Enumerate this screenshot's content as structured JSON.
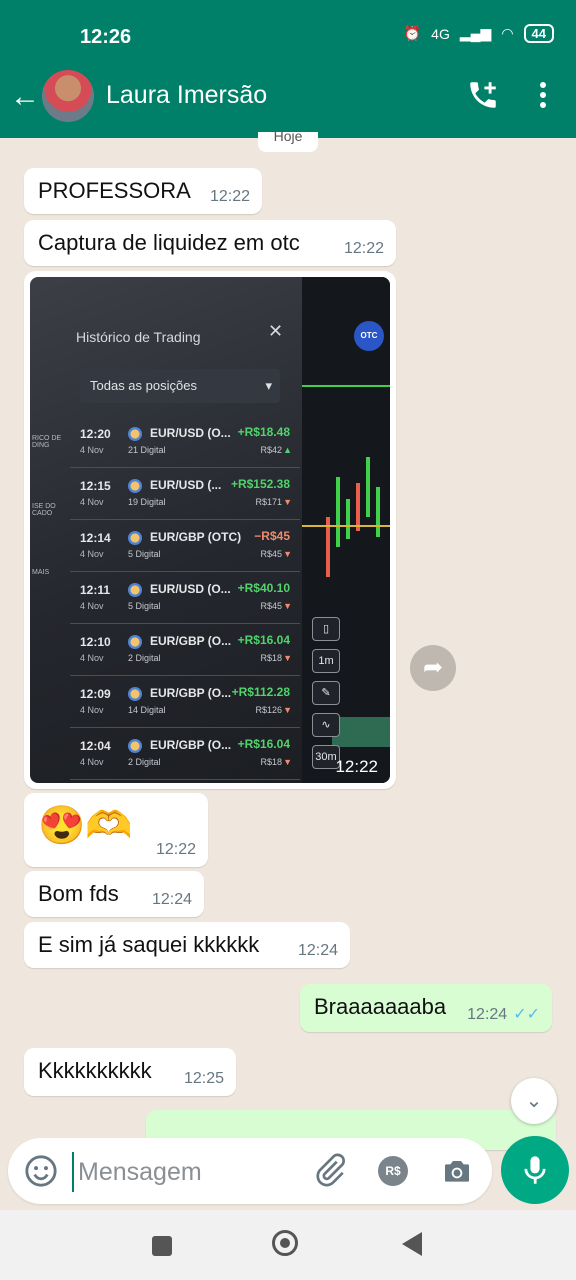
{
  "status": {
    "time": "12:26",
    "network": "4G",
    "battery": "44"
  },
  "header": {
    "contact_name": "Laura Imersão",
    "day_chip": "Hoje"
  },
  "messages": [
    {
      "text": "PROFESSORA",
      "time": "12:22",
      "direction": "in"
    },
    {
      "text": "Captura de liquidez em otc",
      "time": "12:22",
      "direction": "in"
    },
    {
      "type": "image",
      "time": "12:22",
      "direction": "in"
    },
    {
      "emoji": "😍🫶",
      "time": "12:22",
      "direction": "in"
    },
    {
      "text": "Bom fds",
      "time": "12:24",
      "direction": "in"
    },
    {
      "text": "E sim já saquei kkkkkk",
      "time": "12:24",
      "direction": "in"
    },
    {
      "text": "Braaaaaaaba",
      "time": "12:24",
      "direction": "out",
      "status": "read"
    },
    {
      "text": "Kkkkkkkkkk",
      "time": "12:25",
      "direction": "in"
    }
  ],
  "photo": {
    "panel_title": "Histórico de Trading",
    "filter": "Todas as posições",
    "otc_badge": "OTC",
    "sidebar_labels": [
      "RICO DE DING",
      "ISE DO CADO",
      "MAIS"
    ],
    "tools": [
      "1m",
      "30m"
    ],
    "trades": [
      {
        "time": "12:20",
        "date": "4 Nov",
        "pair": "EUR/USD (O...",
        "sub": "21 Digital",
        "pl": "+R$18.48",
        "stake": "R$42",
        "dir": "up"
      },
      {
        "time": "12:15",
        "date": "4 Nov",
        "pair": "EUR/USD (...",
        "sub": "19 Digital",
        "pl": "+R$152.38",
        "stake": "R$171",
        "dir": "down"
      },
      {
        "time": "12:14",
        "date": "4 Nov",
        "pair": "EUR/GBP (OTC)",
        "sub": "5 Digital",
        "pl": "−R$45",
        "stake": "R$45",
        "dir": "down"
      },
      {
        "time": "12:11",
        "date": "4 Nov",
        "pair": "EUR/USD (O...",
        "sub": "5 Digital",
        "pl": "+R$40.10",
        "stake": "R$45",
        "dir": "down"
      },
      {
        "time": "12:10",
        "date": "4 Nov",
        "pair": "EUR/GBP (O...",
        "sub": "2 Digital",
        "pl": "+R$16.04",
        "stake": "R$18",
        "dir": "down"
      },
      {
        "time": "12:09",
        "date": "4 Nov",
        "pair": "EUR/GBP (O...",
        "sub": "14 Digital",
        "pl": "+R$112.28",
        "stake": "R$126",
        "dir": "down"
      },
      {
        "time": "12:04",
        "date": "4 Nov",
        "pair": "EUR/GBP (O...",
        "sub": "2 Digital",
        "pl": "+R$16.04",
        "stake": "R$18",
        "dir": "down"
      }
    ]
  },
  "composer": {
    "placeholder": "Mensagem",
    "pay_label": "R$"
  },
  "colors": {
    "header": "#008069",
    "outgoing": "#d9fdd3",
    "accent": "#00a884",
    "read_ticks": "#53bdeb"
  }
}
